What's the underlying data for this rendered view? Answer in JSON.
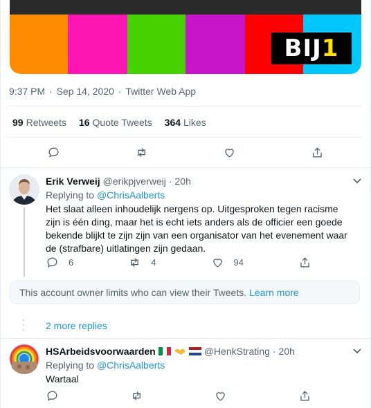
{
  "media": {
    "colors": [
      "#ff8c00",
      "#ff14b4",
      "#46d200",
      "#c814c8",
      "#ff0000",
      "#00c8ff"
    ],
    "logo_text": "BIJ",
    "logo_digit": "1"
  },
  "tweet_meta": {
    "time": "9:37 PM",
    "date": "Sep 14, 2020",
    "source": "Twitter Web App"
  },
  "stats": {
    "retweets_count": "99",
    "retweets_label": "Retweets",
    "quotes_count": "16",
    "quotes_label": "Quote Tweets",
    "likes_count": "364",
    "likes_label": "Likes"
  },
  "main_actions": [
    "reply-icon",
    "retweet-icon",
    "like-icon",
    "share-icon"
  ],
  "replies": [
    {
      "name": "Erik Verweij",
      "handle": "@erikpjverweij",
      "time": "20h",
      "replying_prefix": "Replying to",
      "replying_to": "@ChrisAalberts",
      "text": "Het slaat alleen inhoudelijk nergens op. Uitgesproken tegen racisme zijn is één ding, maar het is echt iets anders als de officier een goede bekende blijkt te zijn zijn van een organisator van het evenement waar de (strafbare) uitlatingen zijn gedaan.",
      "reply_count": "6",
      "retweet_count": "4",
      "like_count": "94"
    },
    {
      "name": "HSArbeidsvoorwaarden",
      "handle": "@HenkStrating",
      "time": "20h",
      "replying_prefix": "Replying to",
      "replying_to": "@ChrisAalberts",
      "text": "Wartaal",
      "reply_count": "",
      "retweet_count": "",
      "like_count": ""
    }
  ],
  "notice": {
    "text": "This account owner limits who can view their Tweets.",
    "link": "Learn more"
  },
  "more_replies": "2 more replies"
}
